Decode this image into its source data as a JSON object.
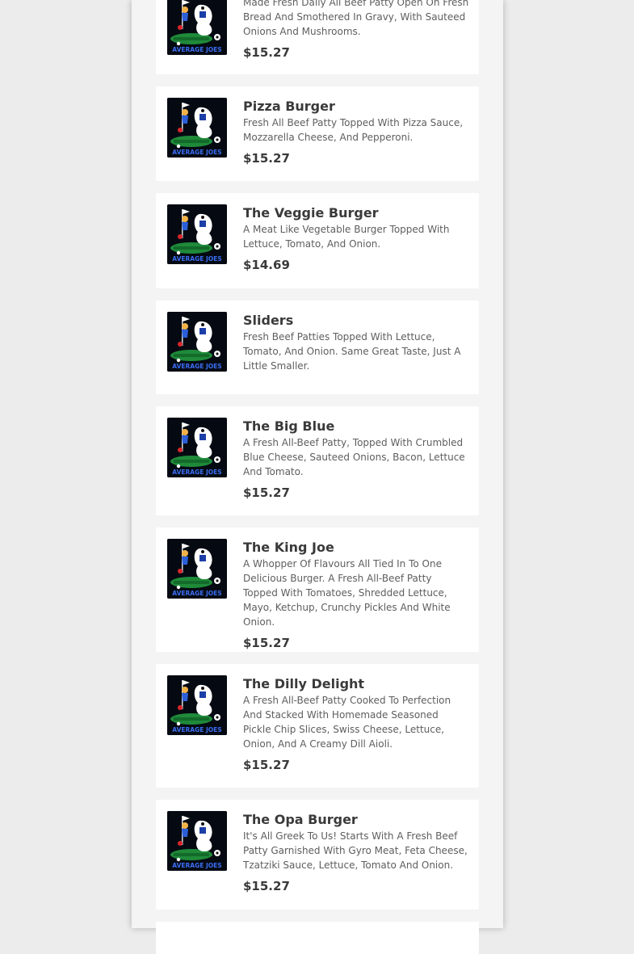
{
  "menu": {
    "items": [
      {
        "name": "",
        "description": "Made Fresh Daily All Beef Patty Open On Fresh Bread And Smothered In Gravy, With Sauteed Onions And Mushrooms.",
        "price": "$15.27",
        "image": "average-joes-logo"
      },
      {
        "name": "Pizza Burger",
        "description": "Fresh All Beef Patty Topped With Pizza Sauce, Mozzarella Cheese, And Pepperoni.",
        "price": "$15.27",
        "image": "average-joes-logo"
      },
      {
        "name": "The Veggie Burger",
        "description": "A Meat Like Vegetable Burger Topped With Lettuce, Tomato, And Onion.",
        "price": "$14.69",
        "image": "average-joes-logo"
      },
      {
        "name": "Sliders",
        "description": "Fresh Beef Patties Topped With Lettuce, Tomato, And Onion. Same Great Taste, Just A Little Smaller.",
        "price": "",
        "image": "average-joes-logo"
      },
      {
        "name": "The Big Blue",
        "description": "A Fresh All-Beef Patty, Topped With Crumbled Blue Cheese, Sauteed Onions, Bacon, Lettuce And Tomato.",
        "price": "$15.27",
        "image": "average-joes-logo"
      },
      {
        "name": "The King Joe",
        "description": "A Whopper Of Flavours All Tied In To One Delicious Burger. A Fresh All-Beef Patty Topped With Tomatoes, Shredded Lettuce, Mayo, Ketchup, Crunchy Pickles And White Onion.",
        "price": "$15.27",
        "image": "average-joes-logo"
      },
      {
        "name": "The Dilly Delight",
        "description": "A Fresh All-Beef Patty Cooked To Perfection And Stacked With Homemade Seasoned Pickle Chip Slices, Swiss Cheese, Lettuce, Onion, And A Creamy Dill Aioli.",
        "price": "$15.27",
        "image": "average-joes-logo"
      },
      {
        "name": "The Opa Burger",
        "description": "It's All Greek To Us! Starts With A Fresh Beef Patty Garnished With Gyro Meat, Feta Cheese, Tzatziki Sauce, Lettuce, Tomato And Onion.",
        "price": "$15.27",
        "image": "average-joes-logo"
      }
    ]
  },
  "colors": {
    "page_background": "#ececec",
    "panel_background": "#f4f4f4",
    "card_background": "#ffffff",
    "text_dark": "#3a3a3a",
    "text_muted": "#5e5e5e",
    "logo_background": "#050a12"
  }
}
